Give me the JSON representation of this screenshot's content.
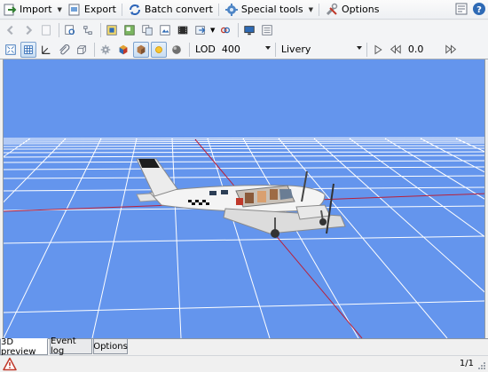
{
  "menubar": {
    "import_label": "Import",
    "export_label": "Export",
    "batch_label": "Batch convert",
    "special_label": "Special tools",
    "options_label": "Options"
  },
  "toolbar2": {
    "lod_label": "LOD",
    "lod_value": "400",
    "livery_value": "Livery",
    "zoom_value": "0.0"
  },
  "tabs": [
    "3D preview",
    "Event log",
    "Options"
  ],
  "status": {
    "pager": "1/1"
  },
  "colors": {
    "viewport_bg": "#6495ed",
    "grid": "#ffffff",
    "axis_red": "#b9203a"
  },
  "icons": [
    "import-icon",
    "export-icon",
    "batch-convert-icon",
    "special-tools-icon",
    "options-icon",
    "help-icon",
    "warning-icon"
  ]
}
